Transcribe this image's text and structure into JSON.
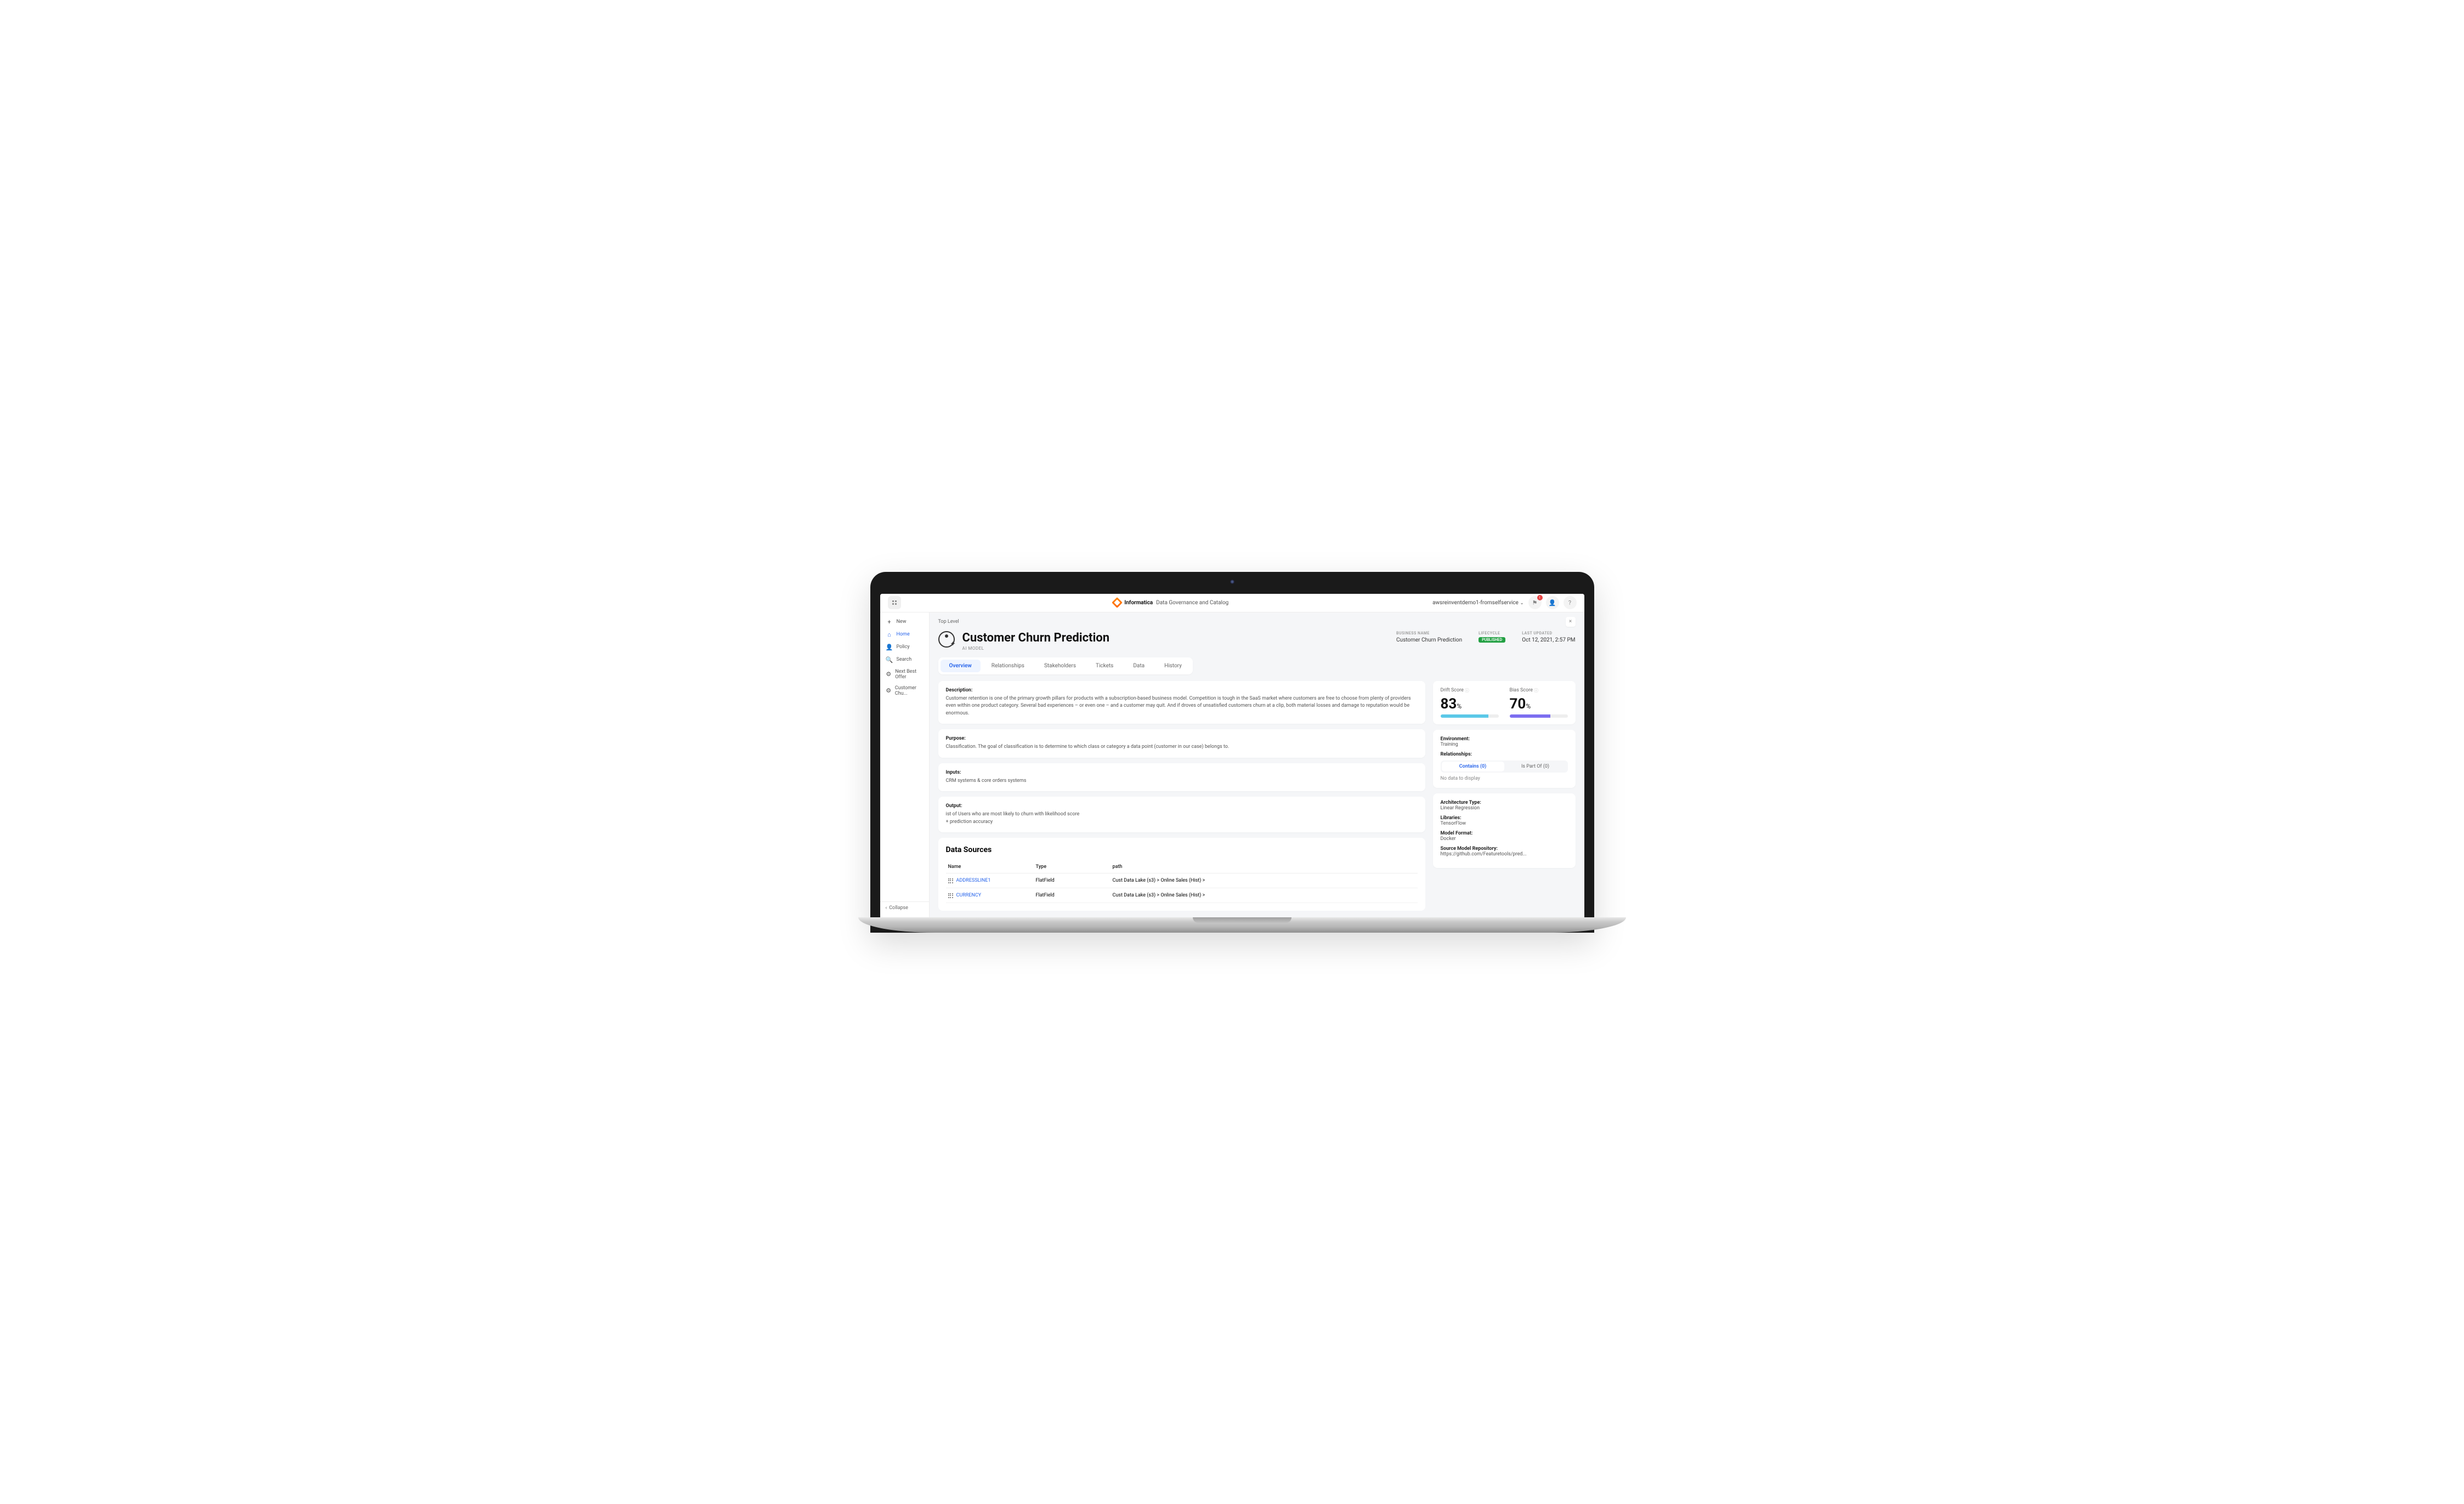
{
  "header": {
    "brand": "Informatica",
    "sub": "Data Governance and Catalog",
    "user": "awsreinventdemo1-fromselfservice",
    "notification_count": "1"
  },
  "sidebar": {
    "items": [
      {
        "icon": "+",
        "label": "New"
      },
      {
        "icon": "⌂",
        "label": "Home"
      },
      {
        "icon": "👤",
        "label": "Policy"
      },
      {
        "icon": "🔍",
        "label": "Search"
      },
      {
        "icon": "⚙",
        "label": "Next Best Offer"
      },
      {
        "icon": "⚙",
        "label": "Customer Chu..."
      }
    ],
    "collapse": "Collapse"
  },
  "breadcrumb": "Top Level",
  "page": {
    "title": "Customer Churn Prediction",
    "subtitle": "AI MODEL",
    "business_name_label": "BUSINESS NAME",
    "business_name": "Customer Churn Prediction",
    "lifecycle_label": "LIFECYCLE",
    "lifecycle": "PUBLISHED",
    "last_updated_label": "LAST UPDATED",
    "last_updated": "Oct 12, 2021, 2:57 PM"
  },
  "tabs": [
    "Overview",
    "Relationships",
    "Stakeholders",
    "Tickets",
    "Data",
    "History"
  ],
  "overview": {
    "description_label": "Description:",
    "description": "Customer retention is one of the primary growth pillars for products with a subscription-based business model. Competition is tough in the SaaS market where customers are free to choose from plenty of providers even within one product category. Several bad experiences – or even one – and a customer may quit. And if droves of unsatisfied customers churn at a clip, both material losses and damage to reputation would be enormous.",
    "purpose_label": "Purpose:",
    "purpose": "Classification. The goal of classification is to determine to which class or category a data point (customer in our case) belongs to.",
    "inputs_label": "Inputs:",
    "inputs": "CRM systems & core orders systems",
    "output_label": "Output:",
    "output": "ist of Users who are most likely to churn with likelihood score\n+ prediction accuracy"
  },
  "scores": {
    "drift_label": "Drift Score",
    "drift_value": "83",
    "drift_pct_width": "83%",
    "bias_label": "Bias Score",
    "bias_value": "70",
    "bias_pct_width": "70%",
    "pct_suffix": "%"
  },
  "relationships": {
    "env_label": "Environment:",
    "env_value": "Training",
    "rel_label": "Relationships:",
    "contains": "Contains (0)",
    "part_of": "Is Part Of (0)",
    "no_data": "No data to display"
  },
  "modelinfo": {
    "arch_label": "Architecture Type:",
    "arch_value": "Linear Regression",
    "lib_label": "Libraries:",
    "lib_value": "TensorFlow",
    "fmt_label": "Model Format:",
    "fmt_value": "Docker",
    "repo_label": "Source Model Repository:",
    "repo_value": "https://github.com/Featuretools/pred..."
  },
  "datasources": {
    "title": "Data Sources",
    "columns": {
      "name": "Name",
      "type": "Type",
      "path": "path"
    },
    "rows": [
      {
        "name": "ADDRESSLINE1",
        "type": "FlatField",
        "path": "Cust Data Lake (s3) > Online Sales (Hist) >"
      },
      {
        "name": "CURRENCY",
        "type": "FlatField",
        "path": "Cust Data Lake (s3) > Online Sales (Hist) >"
      }
    ]
  }
}
